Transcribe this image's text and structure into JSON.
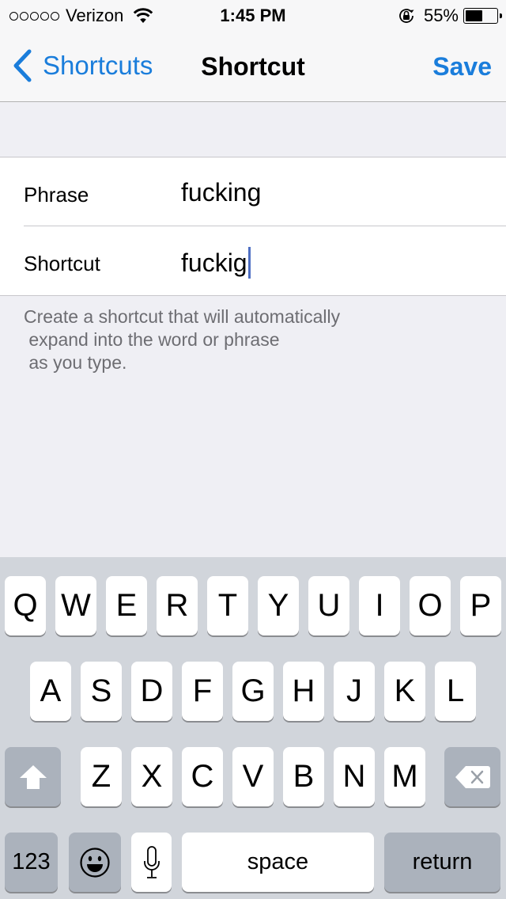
{
  "status_bar": {
    "signal_dots": 5,
    "carrier": "Verizon",
    "wifi_icon": "wifi-icon",
    "time": "1:45 PM",
    "orientation_lock_icon": "orientation-lock-icon",
    "battery_percent_label": "55%",
    "battery_level": 0.55
  },
  "nav": {
    "back_label": "Shortcuts",
    "title": "Shortcut",
    "save_label": "Save",
    "accent_color": "#1a7ddb"
  },
  "form": {
    "rows": [
      {
        "label": "Phrase",
        "value": "fucking"
      },
      {
        "label": "Shortcut",
        "value": "fuckig"
      }
    ],
    "footer_lines": [
      "Create a shortcut that will automatically",
      " expand into the word or phrase",
      " as you type."
    ]
  },
  "keyboard": {
    "row1": [
      "Q",
      "W",
      "E",
      "R",
      "T",
      "Y",
      "U",
      "I",
      "O",
      "P"
    ],
    "row2": [
      "A",
      "S",
      "D",
      "F",
      "G",
      "H",
      "J",
      "K",
      "L"
    ],
    "row3": [
      "Z",
      "X",
      "C",
      "V",
      "B",
      "N",
      "M"
    ],
    "numbers_label": "123",
    "space_label": "space",
    "return_label": "return",
    "shift_icon": "shift-icon",
    "delete_icon": "delete-icon",
    "emoji_icon": "emoji-icon",
    "mic_icon": "microphone-icon"
  }
}
